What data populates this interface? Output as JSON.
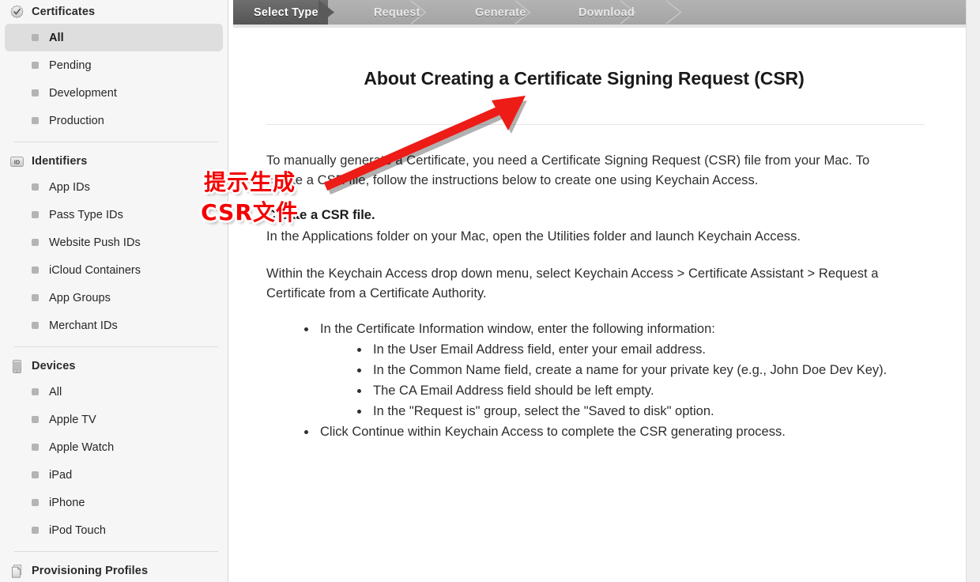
{
  "sidebar": {
    "sections": [
      {
        "id": "certificates",
        "icon": "certificate-seal-icon",
        "label": "Certificates",
        "items": [
          {
            "label": "All",
            "selected": true
          },
          {
            "label": "Pending",
            "selected": false
          },
          {
            "label": "Development",
            "selected": false
          },
          {
            "label": "Production",
            "selected": false
          }
        ]
      },
      {
        "id": "identifiers",
        "icon": "id-badge-icon",
        "label": "Identifiers",
        "items": [
          {
            "label": "App IDs",
            "selected": false
          },
          {
            "label": "Pass Type IDs",
            "selected": false
          },
          {
            "label": "Website Push IDs",
            "selected": false
          },
          {
            "label": "iCloud Containers",
            "selected": false
          },
          {
            "label": "App Groups",
            "selected": false
          },
          {
            "label": "Merchant IDs",
            "selected": false
          }
        ]
      },
      {
        "id": "devices",
        "icon": "device-icon",
        "label": "Devices",
        "items": [
          {
            "label": "All",
            "selected": false
          },
          {
            "label": "Apple TV",
            "selected": false
          },
          {
            "label": "Apple Watch",
            "selected": false
          },
          {
            "label": "iPad",
            "selected": false
          },
          {
            "label": "iPhone",
            "selected": false
          },
          {
            "label": "iPod Touch",
            "selected": false
          }
        ]
      },
      {
        "id": "provisioning-profiles",
        "icon": "document-pages-icon",
        "label": "Provisioning Profiles",
        "items": []
      }
    ]
  },
  "steps": {
    "items": [
      {
        "label": "Select Type",
        "active": true
      },
      {
        "label": "Request",
        "active": false
      },
      {
        "label": "Generate",
        "active": false
      },
      {
        "label": "Download",
        "active": false
      }
    ]
  },
  "main": {
    "title": "About Creating a Certificate Signing Request (CSR)",
    "intro": "To manually generate a Certificate, you need a Certificate Signing Request (CSR) file from your Mac. To create a CSR file, follow the instructions below to create one using Keychain Access.",
    "subhead": "Create a CSR file.",
    "applications_para": "In the Applications folder on your Mac, open the Utilities folder and launch Keychain Access.",
    "within_para": "Within the Keychain Access drop down menu, select Keychain Access > Certificate Assistant > Request a Certificate from a Certificate Authority.",
    "bullet_info": "In the Certificate Information window, enter the following information:",
    "sub_bullets": [
      "In the User Email Address field, enter your email address.",
      "In the Common Name field, create a name for your private key (e.g., John Doe Dev Key).",
      "The CA Email Address field should be left empty.",
      "In the \"Request is\" group, select the \"Saved to disk\" option."
    ],
    "bullet_continue": "Click Continue within Keychain Access to complete the CSR generating process."
  },
  "annotation": {
    "line1": "提示生成",
    "line2": "CSR文件",
    "color": "#f40000"
  },
  "colors": {
    "sidebar_bg": "#f6f6f6",
    "sidebar_selected": "#dedede",
    "steps_bar": "#aaaaaa",
    "step_active": "#555555",
    "annotation_red": "#f40000"
  }
}
